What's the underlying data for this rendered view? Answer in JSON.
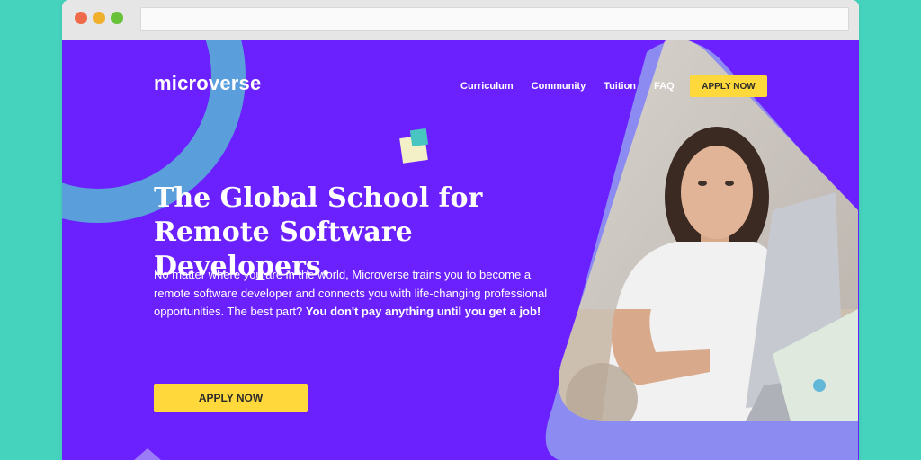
{
  "logo": "microverse",
  "nav": {
    "items": [
      "Curriculum",
      "Community",
      "Tuition",
      "FAQ"
    ],
    "cta": "APPLY NOW"
  },
  "hero": {
    "title": "The Global School for Remote Software Developers.",
    "lead_text": "No matter where you are in the world, Microverse trains you to become a remote software developer and connects you with life-changing professional opportunities. The best part? ",
    "lead_bold": "You don't pay anything until you get a job!",
    "cta": "APPLY NOW"
  },
  "colors": {
    "page_bg": "#6b21fd",
    "outer_bg": "#46d3bd",
    "accent": "#ffd93c",
    "arc": "#5a9fdc",
    "triangle": "#8c8bf2"
  }
}
